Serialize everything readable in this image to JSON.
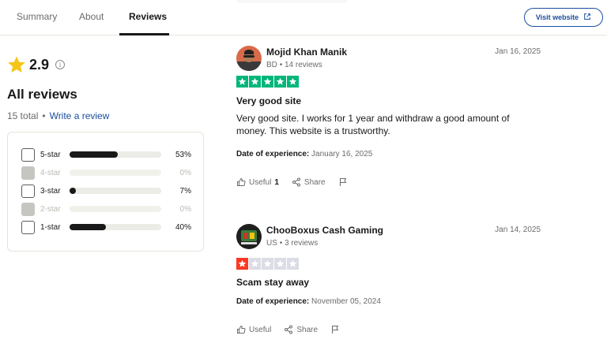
{
  "tabs": [
    {
      "label": "Summary",
      "active": false
    },
    {
      "label": "About",
      "active": false
    },
    {
      "label": "Reviews",
      "active": true
    }
  ],
  "header": {
    "visit_label": "Visit website",
    "visit_icon": "external-link-icon"
  },
  "summary": {
    "rating": "2.9",
    "star_color": "#f5c518",
    "all_reviews_title": "All reviews",
    "total": "15 total",
    "separator": "•",
    "write_review": "Write a review"
  },
  "breakdown": [
    {
      "label": "5-star",
      "percent": "53%",
      "fraction": 0.53,
      "enabled": true
    },
    {
      "label": "4-star",
      "percent": "0%",
      "fraction": 0,
      "enabled": false
    },
    {
      "label": "3-star",
      "percent": "7%",
      "fraction": 0.07,
      "enabled": true
    },
    {
      "label": "2-star",
      "percent": "0%",
      "fraction": 0,
      "enabled": false
    },
    {
      "label": "1-star",
      "percent": "40%",
      "fraction": 0.4,
      "enabled": true
    }
  ],
  "colors": {
    "star_green": "#00b67a",
    "star_red": "#ff3722",
    "star_empty": "#dcdce6",
    "link_blue": "#1c4ea0"
  },
  "reviews": [
    {
      "name": "Mojid Khan Manik",
      "country": "BD",
      "review_count": "14 reviews",
      "date": "Jan 16, 2025",
      "stars": 5,
      "title": "Very good site",
      "body": "Very good site. I works for 1 year and withdraw a good amount of money. This website is a trustworthy.",
      "experience_label": "Date of experience:",
      "experience_date": "January 16, 2025",
      "useful_label": "Useful",
      "useful_count": "1",
      "share_label": "Share"
    },
    {
      "name": "ChooBoxus Cash Gaming",
      "country": "US",
      "review_count": "3 reviews",
      "date": "Jan 14, 2025",
      "stars": 1,
      "title": "Scam stay away",
      "body": "",
      "experience_label": "Date of experience:",
      "experience_date": "November 05, 2024",
      "useful_label": "Useful",
      "useful_count": "",
      "share_label": "Share"
    }
  ]
}
